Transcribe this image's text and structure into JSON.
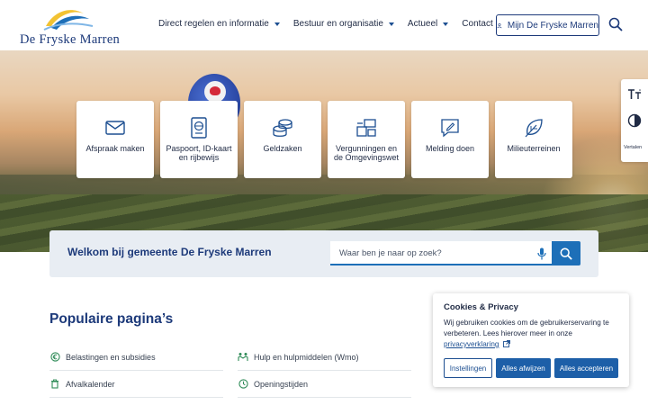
{
  "header": {
    "logo_text": "De Fryske Marren",
    "nav": [
      {
        "label": "Direct regelen en informatie",
        "has_dropdown": true
      },
      {
        "label": "Bestuur en organisatie",
        "has_dropdown": true
      },
      {
        "label": "Actueel",
        "has_dropdown": true
      },
      {
        "label": "Contact",
        "has_dropdown": false
      }
    ],
    "account_button": "Mijn De Fryske Marren",
    "search_icon": "search-icon"
  },
  "side_panel": {
    "text_size_icon": "text-size-icon",
    "contrast_icon": "contrast-icon",
    "translate_label": "Vertalen"
  },
  "tiles": [
    {
      "label": "Afspraak maken",
      "icon": "envelope-icon"
    },
    {
      "label": "Paspoort, ID-kaart en rijbewijs",
      "icon": "passport-icon"
    },
    {
      "label": "Geldzaken",
      "icon": "coins-icon"
    },
    {
      "label": "Vergunningen en de Omgevingswet",
      "icon": "building-permit-icon"
    },
    {
      "label": "Melding doen",
      "icon": "report-icon"
    },
    {
      "label": "Milieuterreinen",
      "icon": "leaf-icon"
    }
  ],
  "welcome": {
    "title": "Welkom bij gemeente De Fryske Marren",
    "search_placeholder": "Waar ben je naar op zoek?"
  },
  "popular": {
    "title": "Populaire pagina’s",
    "items": [
      {
        "label": "Belastingen en subsidies",
        "icon": "euro-icon"
      },
      {
        "label": "Hulp en hulpmiddelen (Wmo)",
        "icon": "support-icon"
      },
      {
        "label": "Afvalkalender",
        "icon": "trash-icon"
      },
      {
        "label": "Openingstijden",
        "icon": "clock-icon"
      }
    ]
  },
  "cookie": {
    "title": "Cookies & Privacy",
    "text": "Wij gebruiken cookies om de gebruikerservaring te verbeteren. Lees hierover meer in onze",
    "link": "privacyverklaring",
    "buttons": {
      "settings": "Instellingen",
      "reject": "Alles afwijzen",
      "accept": "Alles accepteren"
    }
  },
  "colors": {
    "brand": "#1d3a7a",
    "accent": "#1d6fb8",
    "icon_green": "#2e8b57"
  }
}
